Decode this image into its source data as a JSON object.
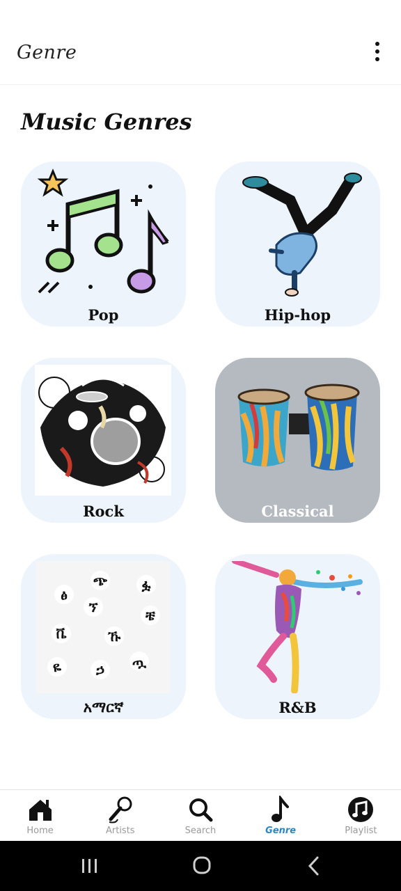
{
  "app_bar": {
    "title": "Genre",
    "menu_icon": "more-vert-icon"
  },
  "section_title": "Music Genres",
  "genres": [
    {
      "label": "Pop",
      "icon": "music-notes-illustration"
    },
    {
      "label": "Hip-hop",
      "icon": "breakdancer-illustration"
    },
    {
      "label": "Rock",
      "icon": "drum-kit-splash-illustration"
    },
    {
      "label": "Classical",
      "icon": "bongo-drums-photo"
    },
    {
      "label": "አማርኛ",
      "icon": "amharic-letters-illustration"
    },
    {
      "label": "R&B",
      "icon": "colorful-dancer-illustration"
    }
  ],
  "bottom_nav": [
    {
      "label": "Home",
      "icon": "home-icon",
      "active": false
    },
    {
      "label": "Artists",
      "icon": "microphone-icon",
      "active": false
    },
    {
      "label": "Search",
      "icon": "search-icon",
      "active": false
    },
    {
      "label": "Genre",
      "icon": "music-note-icon",
      "active": true
    },
    {
      "label": "Playlist",
      "icon": "playlist-icon",
      "active": false
    }
  ],
  "colors": {
    "accent": "#2a86c4",
    "card_bg": "#eef4fc",
    "classical_card_bg": "#b5bac1"
  }
}
